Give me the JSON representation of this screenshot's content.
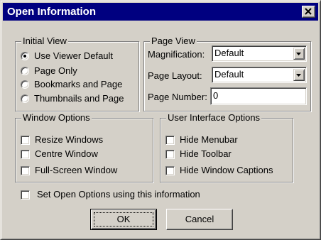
{
  "window": {
    "title": "Open Information",
    "close_icon": "close-icon"
  },
  "initial_view": {
    "legend": "Initial View",
    "options": [
      {
        "label": "Use Viewer Default",
        "checked": true
      },
      {
        "label": "Page Only",
        "checked": false
      },
      {
        "label": "Bookmarks and Page",
        "checked": false
      },
      {
        "label": "Thumbnails and Page",
        "checked": false
      }
    ]
  },
  "page_view": {
    "legend": "Page View",
    "magnification_label": "Magnification:",
    "magnification_value": "Default",
    "page_layout_label": "Page Layout:",
    "page_layout_value": "Default",
    "page_number_label": "Page Number:",
    "page_number_value": "0"
  },
  "window_options": {
    "legend": "Window Options",
    "items": [
      {
        "label": "Resize Windows",
        "checked": false
      },
      {
        "label": "Centre Window",
        "checked": false
      },
      {
        "label": "Full-Screen Window",
        "checked": false
      }
    ]
  },
  "ui_options": {
    "legend": "User Interface Options",
    "items": [
      {
        "label": "Hide Menubar",
        "checked": false
      },
      {
        "label": "Hide Toolbar",
        "checked": false
      },
      {
        "label": "Hide Window Captions",
        "checked": false
      }
    ]
  },
  "set_open_options": {
    "label": "Set Open Options using this information",
    "checked": false
  },
  "buttons": {
    "ok": "OK",
    "cancel": "Cancel"
  },
  "colors": {
    "titlebar": "#000080",
    "face": "#d4d0c8"
  }
}
